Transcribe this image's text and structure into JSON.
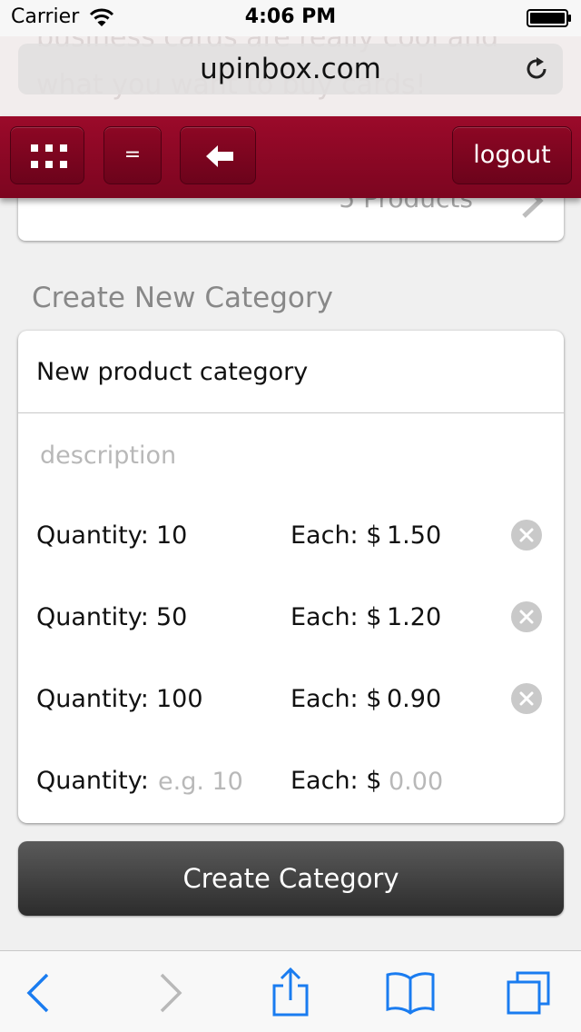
{
  "status_bar": {
    "carrier": "Carrier",
    "time": "4:06 PM"
  },
  "browser": {
    "url": "upinbox.com",
    "background_text": "business cards are really cool and what you want to buy cards!"
  },
  "app_toolbar": {
    "menu_label": "=",
    "logout_label": "logout"
  },
  "top_card": {
    "products_label": "5 Products"
  },
  "form": {
    "section_title": "Create New Category",
    "category_name_value": "New product category",
    "description_placeholder": "description",
    "quantity_label": "Quantity:",
    "each_label": "Each: $",
    "price_rows": [
      {
        "quantity": "10",
        "each": "1.50"
      },
      {
        "quantity": "50",
        "each": "1.20"
      },
      {
        "quantity": "100",
        "each": "0.90"
      }
    ],
    "new_row": {
      "quantity_placeholder": "e.g. 10",
      "each_placeholder": "0.00"
    },
    "submit_label": "Create Category"
  },
  "colors": {
    "toolbar_red": "#8a0624",
    "button_dark": "#3a3a3a",
    "ios_blue": "#1a7cf0",
    "ios_disabled": "#b8b8b8"
  },
  "icons": {
    "wifi": "wifi-icon",
    "battery": "battery-icon",
    "reload": "reload-icon",
    "grid": "grid-icon",
    "back_arrow": "back-arrow-icon",
    "chevron": "chevron-right-icon",
    "remove": "remove-circle-icon",
    "safari_back": "chevron-left-icon",
    "safari_forward": "chevron-right-icon",
    "share": "share-icon",
    "bookmarks": "book-icon",
    "tabs": "tabs-icon"
  }
}
